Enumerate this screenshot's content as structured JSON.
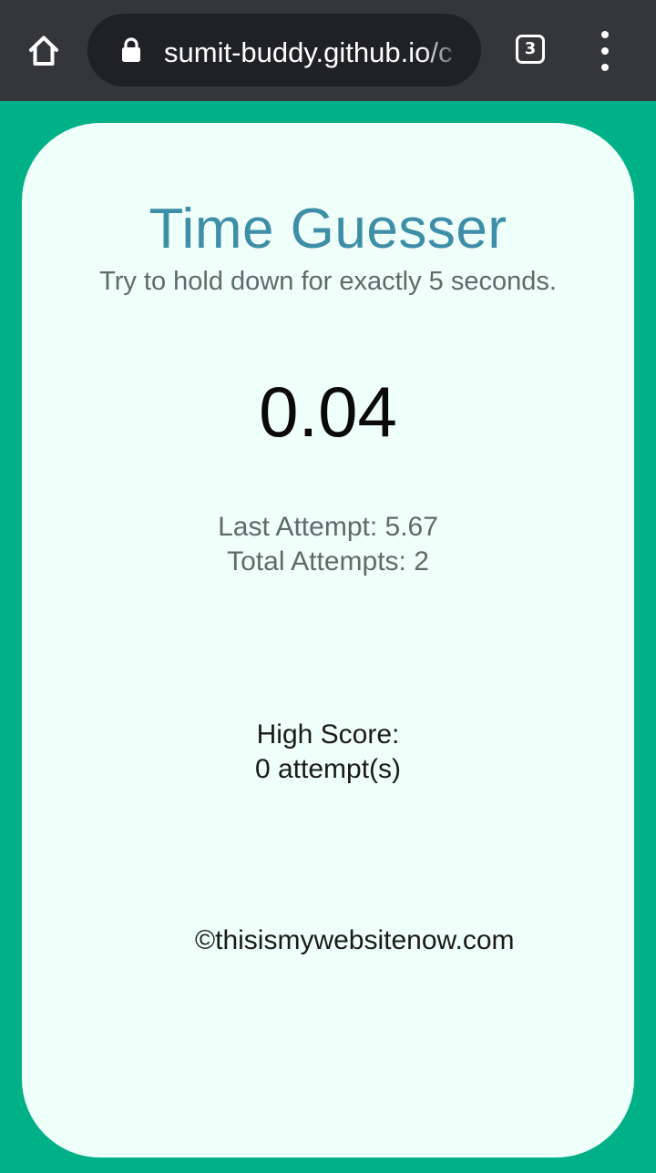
{
  "browser": {
    "url": "sumit-buddy.github.io/c",
    "tab_count": "3"
  },
  "app": {
    "title": "Time Guesser",
    "subtitle": "Try to hold down for exactly 5 seconds.",
    "timer": "0.04",
    "last_attempt": "Last Attempt: 5.67",
    "total_attempts": "Total Attempts: 2",
    "high_score_label": "High Score:",
    "high_score_value": "0 attempt(s)",
    "footer": "©thisismywebsitenow.com"
  },
  "colors": {
    "page_background": "#00b087",
    "card_background": "#effffa",
    "title": "#3e8ea8",
    "browser_bar": "#35363a"
  },
  "icons": [
    "home-icon",
    "lock-icon",
    "tab-switcher-icon",
    "more-vert-icon"
  ]
}
